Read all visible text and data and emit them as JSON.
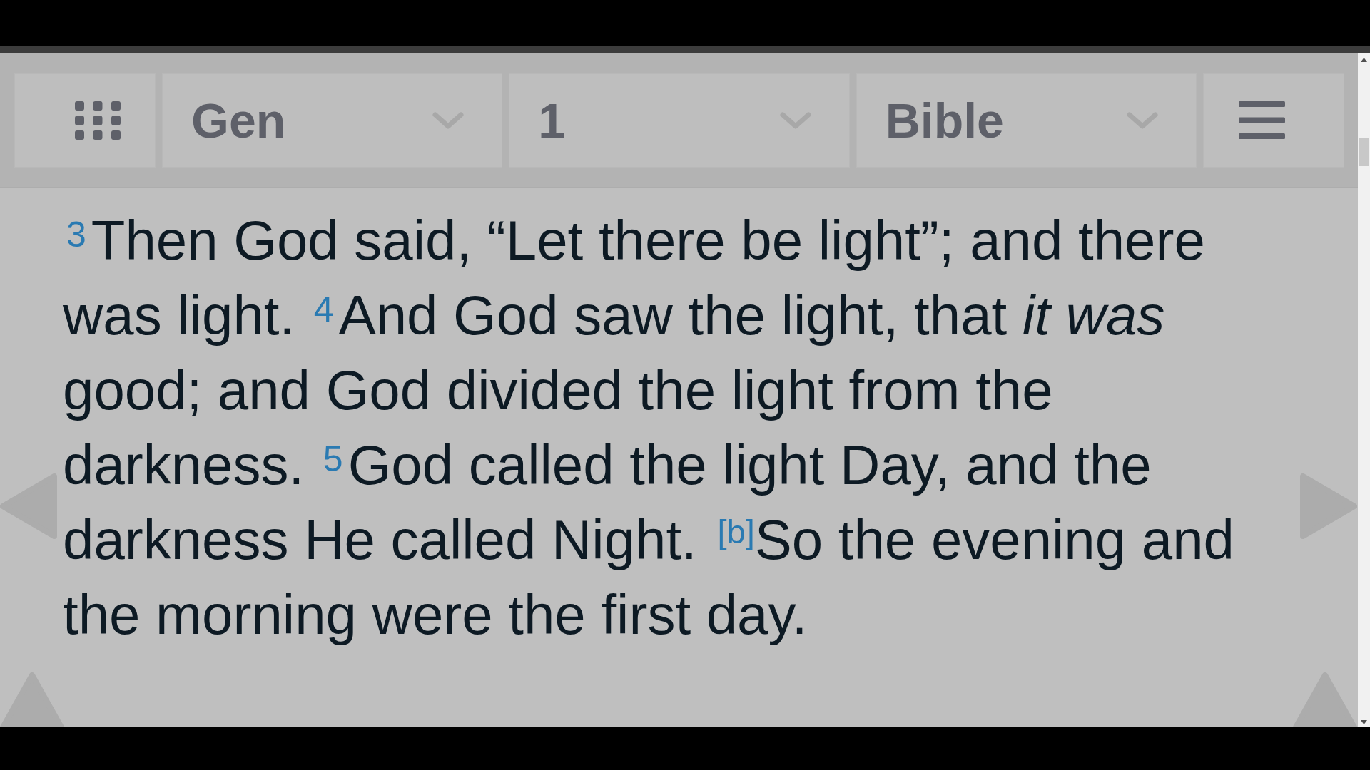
{
  "toolbar": {
    "dropdowns": [
      {
        "value": "Gen"
      },
      {
        "value": "1"
      },
      {
        "value": "Bible"
      }
    ]
  },
  "passage": {
    "segments": [
      {
        "kind": "text",
        "text": "$^{3}$Then God said, “Let there be light”; and there was light. $^{4}$And God saw the light, that *it was* good; and God divided the light from the darkness. $^{5}$God called the light Day, and the darkness He called Night. "
      },
      {
        "kind": "footnote",
        "text": "[b]"
      },
      {
        "kind": "text",
        "text": "So the evening and the morning were the first day."
      }
    ]
  }
}
